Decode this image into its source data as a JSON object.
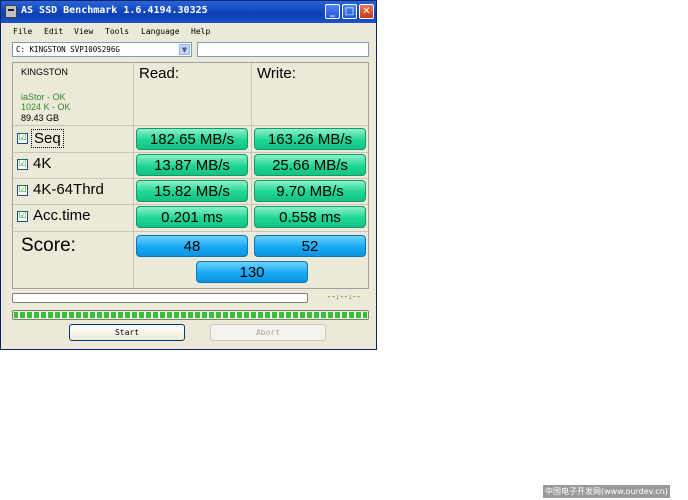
{
  "window": {
    "title": "AS SSD Benchmark 1.6.4194.30325",
    "minimize": "_",
    "maximize": "□",
    "close": "✕"
  },
  "menu": [
    "File",
    "Edit",
    "View",
    "Tools",
    "Language",
    "Help"
  ],
  "drive": {
    "selected": "C: KINGSTON SVP100S296G",
    "dropdown_icon": "▼"
  },
  "info": {
    "model": "KINGSTON",
    "driver": "iaStor - OK",
    "alignment": "1024 K - OK",
    "size": "89.43 GB"
  },
  "columns": {
    "read": "Read:",
    "write": "Write:"
  },
  "rows": [
    {
      "label": "Seq",
      "checked": true,
      "read": "182.65 MB/s",
      "write": "163.26 MB/s"
    },
    {
      "label": "4K",
      "checked": true,
      "read": "13.87 MB/s",
      "write": "25.66 MB/s"
    },
    {
      "label": "4K-64Thrd",
      "checked": true,
      "read": "15.82 MB/s",
      "write": "9.70 MB/s"
    },
    {
      "label": "Acc.time",
      "checked": true,
      "read": "0.201 ms",
      "write": "0.558 ms"
    }
  ],
  "check_glyph": "☑",
  "score": {
    "label": "Score:",
    "read": "48",
    "write": "52",
    "total": "130"
  },
  "progress": {
    "time": "--:--:--",
    "top_fill": 0,
    "bottom_fill": 1.0
  },
  "buttons": {
    "start": "Start",
    "abort": "Abort"
  },
  "watermark": "中国电子开发网(www.ourdev.cn)",
  "colors": {
    "titlebar": "#0a3fb5",
    "result_green": "#1ed694",
    "score_blue": "#17a9f3",
    "progress_green": "#31c231"
  }
}
